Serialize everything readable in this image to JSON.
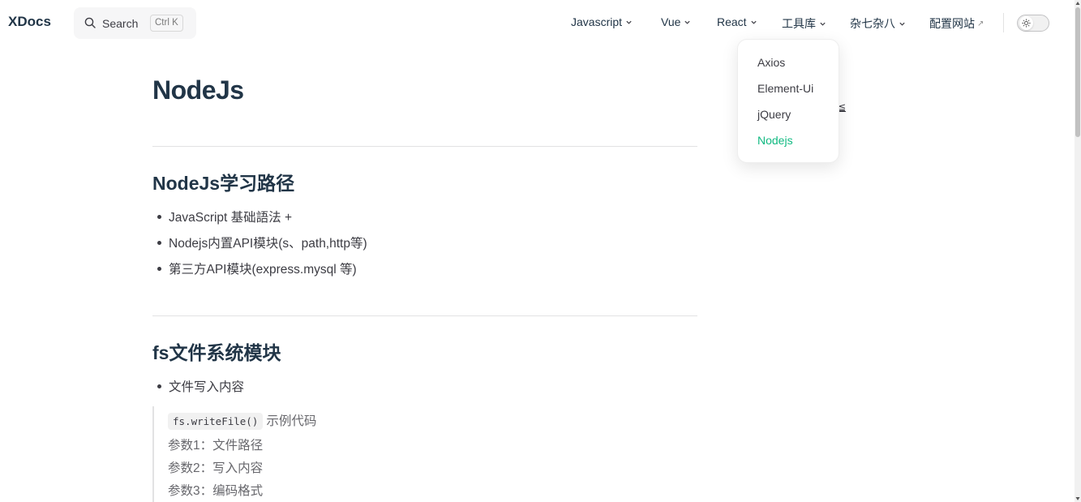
{
  "header": {
    "logo": "XDocs",
    "search": {
      "label": "Search",
      "shortcut": "Ctrl K"
    },
    "nav": [
      {
        "label": "Javascript",
        "has_dropdown": true
      },
      {
        "label": "Vue",
        "has_dropdown": true
      },
      {
        "label": "React",
        "has_dropdown": true
      },
      {
        "label": "工具库",
        "has_dropdown": true
      },
      {
        "label": "杂七杂八",
        "has_dropdown": true
      },
      {
        "label": "配置网站",
        "external": true,
        "external_glyph": "↗"
      }
    ],
    "theme_toggle_icon": "sun-icon"
  },
  "dropdown": {
    "items": [
      {
        "label": "Axios"
      },
      {
        "label": "Element-Ui"
      },
      {
        "label": "jQuery"
      },
      {
        "label": "Nodejs",
        "active": true
      }
    ],
    "active_color": "#10b981"
  },
  "outline_fragment": "≦",
  "content": {
    "title": "NodeJs",
    "sections": [
      {
        "heading": "NodeJs学习路径",
        "items": [
          "JavaScript 基础語法 +",
          "Nodejs内置API模块(s、path,http等)",
          "第三方API模块(express.mysql 等)"
        ]
      },
      {
        "heading": "fs文件系统模块",
        "items": [
          "文件写入内容"
        ],
        "blockquote": {
          "code": "fs.writeFile()",
          "code_suffix": "示例代码",
          "lines": [
            "参数1：文件路径",
            "参数2：写入内容",
            "参数3：编码格式"
          ]
        }
      }
    ]
  }
}
